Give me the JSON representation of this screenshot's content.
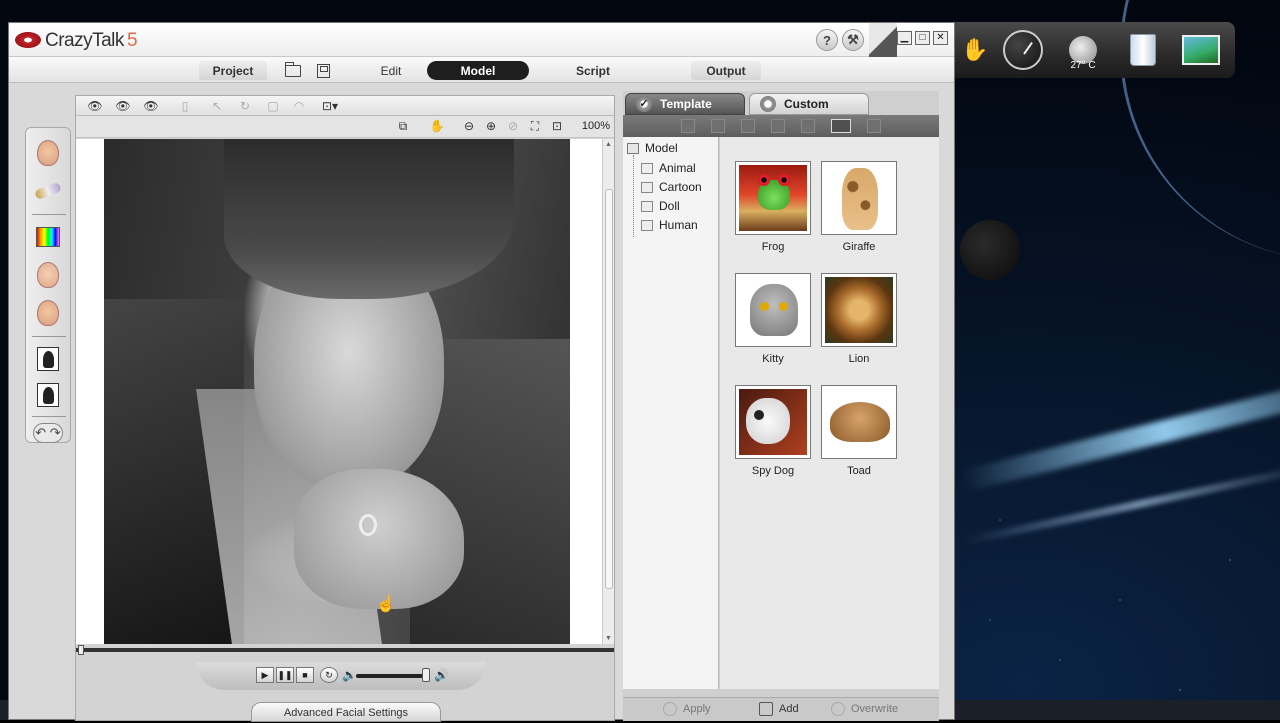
{
  "window": {
    "app_name": "CrazyTalk",
    "app_version": "5"
  },
  "title_buttons": {
    "help": "?",
    "tools": "⚒"
  },
  "window_controls": {
    "minimize": "▁",
    "maximize": "□",
    "close": "✕"
  },
  "menu": {
    "project": "Project",
    "edit": "Edit",
    "model": "Model",
    "script": "Script",
    "output": "Output"
  },
  "viewport": {
    "zoom": "100%",
    "advanced_button": "Advanced Facial Settings"
  },
  "library": {
    "tabs": [
      {
        "label": "Template",
        "active": true
      },
      {
        "label": "Custom",
        "active": false
      }
    ],
    "tree_root": "Model",
    "tree_items": [
      "Animal",
      "Cartoon",
      "Doll",
      "Human"
    ],
    "thumbnails": [
      "Frog",
      "Giraffe",
      "Kitty",
      "Lion",
      "Spy Dog",
      "Toad"
    ],
    "bottom_buttons": {
      "apply": "Apply",
      "add": "Add",
      "overwrite": "Overwrite"
    }
  },
  "desktop": {
    "weather_temp": "27° C"
  },
  "colors": {
    "accent_red": "#c0262c",
    "version_orange": "#e06a4a",
    "active_menu": "#1e1e1e"
  }
}
